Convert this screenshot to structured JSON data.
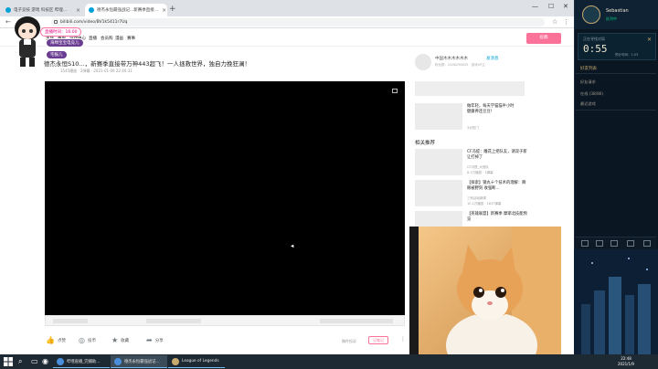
{
  "browser": {
    "tabs": [
      {
        "label": "电子竞技 游戏 科技区 哔哩..."
      },
      {
        "label": "德杰永恒最强战记...新赛季直接..."
      }
    ],
    "new_tab": "+",
    "controls": {
      "minimize": "—",
      "maximize": "☐",
      "close": "✕"
    },
    "back": "←",
    "forward": "→",
    "reload": "↻",
    "url": "bilibili.com/video/BV1k5411r7Uq"
  },
  "bilibili": {
    "nav": [
      "主站",
      "番剧",
      "游戏中心",
      "直播",
      "会员购",
      "漫画",
      "赛事"
    ],
    "upload_label": "投稿",
    "video_title": "德杰永恒S10...，新赛季直接带万神443超飞！一人拯救世界，独自力挽狂澜！",
    "video_meta": "3545播放 · 2弹幕 · 2021-01-09 22:46:31",
    "up_name": "中国木木木木木木",
    "follow_label": "发消息",
    "up_desc": "粉丝数：2446296835 · 游戏UP主",
    "promo_title": "做年轻，每天学猫猫半小时",
    "promo_sub": "健康养连豆豆!",
    "promo_tag": "3点热门",
    "reco_title": "相关推荐",
    "reco_items": [
      {
        "title": "CF冯提：雕花上把队友，请双子新让打掉了",
        "sub1": "CF冯提_大冠队",
        "sub2": "8.1万播放 · 1弹幕"
      },
      {
        "title": "【探索】钢丸十个技术的理解：瞬眼被野刻 收强断...",
        "sub1": "三科活动新闻",
        "sub2": "10.1万播放 · 1837弹幕"
      },
      {
        "title": "【英雄联盟】新赛季 摩耶北技能预览",
        "sub1": "",
        "sub2": ""
      }
    ],
    "actions": {
      "like": "点赞",
      "coin": "投币",
      "fav": "收藏",
      "share": "分享"
    },
    "report_label": "稿件投诉",
    "notes_label": "记笔记",
    "more": "⋮"
  },
  "overlay": {
    "live_time": "直播时间：16:00",
    "badge2": "海绵宝宝电竞儿",
    "badge3": "宅报儿"
  },
  "lol": {
    "name": "Sebastian",
    "status": "队列中",
    "queue_label": "正在寻找对局",
    "timer": "0:55",
    "est": "预计时间：1:03",
    "close": "✕",
    "list_head": "好友列表",
    "rows": [
      "好友请求",
      "在线 (38/86)",
      "最近游戏"
    ]
  },
  "taskbar": {
    "apps": [
      {
        "label": "哔哩直播_完播助..."
      },
      {
        "label": "德杰永恒最强战记..."
      },
      {
        "label": "League of Legends"
      }
    ],
    "time": "22:48",
    "date": "2021/1/9"
  },
  "colors": {
    "bili_pink": "#fb7299",
    "bili_blue": "#00a1d6",
    "lol_gold": "#c8aa6e"
  }
}
